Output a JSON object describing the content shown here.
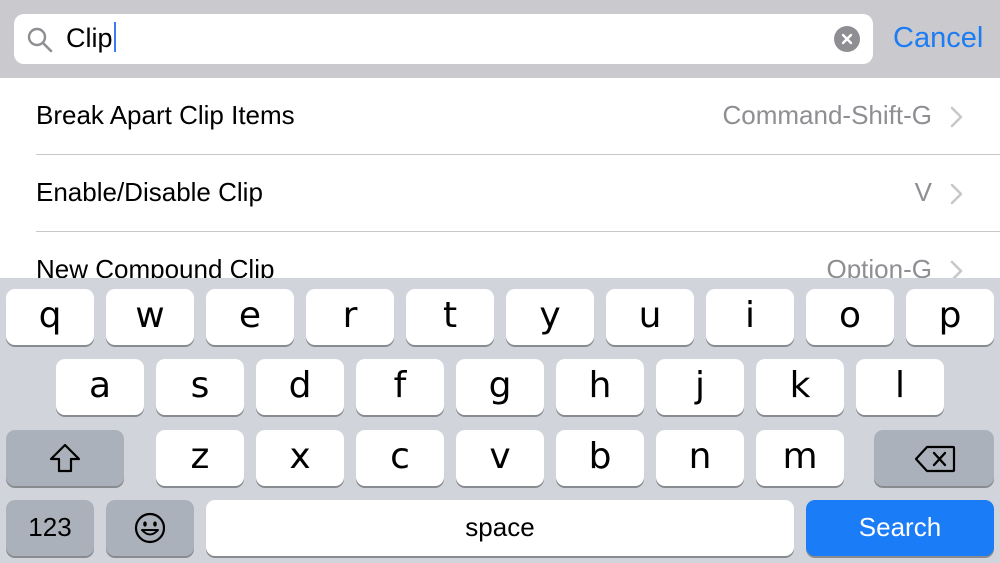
{
  "search": {
    "query": "Clip",
    "cancel_label": "Cancel"
  },
  "results": [
    {
      "title": "Break Apart Clip Items",
      "shortcut": "Command-Shift-G"
    },
    {
      "title": "Enable/Disable Clip",
      "shortcut": "V"
    },
    {
      "title": "New Compound Clip",
      "shortcut": "Option-G"
    }
  ],
  "keyboard": {
    "row1": [
      "q",
      "w",
      "e",
      "r",
      "t",
      "y",
      "u",
      "i",
      "o",
      "p"
    ],
    "row2": [
      "a",
      "s",
      "d",
      "f",
      "g",
      "h",
      "j",
      "k",
      "l"
    ],
    "row3": [
      "z",
      "x",
      "c",
      "v",
      "b",
      "n",
      "m"
    ],
    "numbers_label": "123",
    "space_label": "space",
    "search_label": "Search",
    "shift_icon": "shift-icon",
    "delete_icon": "delete-icon",
    "emoji_icon": "emoji-icon"
  },
  "colors": {
    "accent": "#1d7cf2",
    "search_key": "#1b7cf7",
    "keyboard_bg": "#d1d5db",
    "search_bar_bg": "#c9c9ce"
  }
}
